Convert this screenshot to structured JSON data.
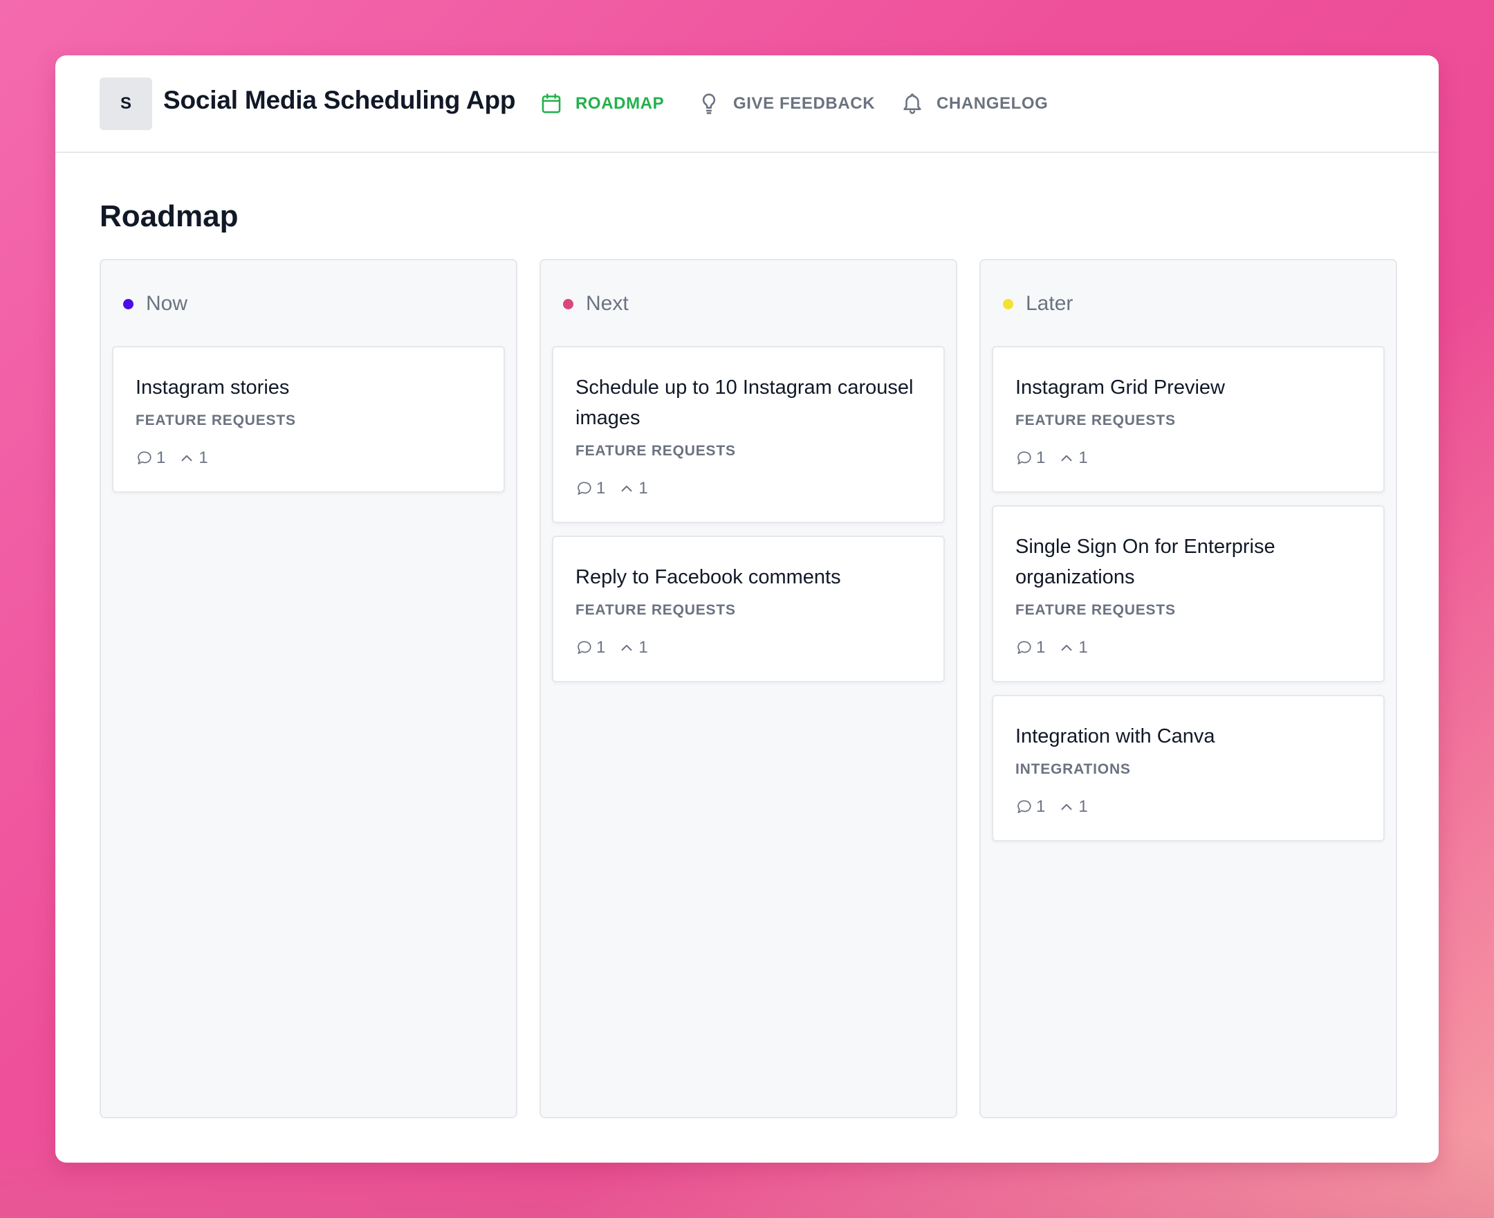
{
  "app": {
    "logo_letter": "S",
    "title": "Social Media Scheduling App"
  },
  "nav": {
    "items": [
      {
        "label": "ROADMAP",
        "icon": "calendar-icon",
        "active": true
      },
      {
        "label": "GIVE FEEDBACK",
        "icon": "lightbulb-icon",
        "active": false
      },
      {
        "label": "CHANGELOG",
        "icon": "bell-icon",
        "active": false
      }
    ]
  },
  "page": {
    "title": "Roadmap"
  },
  "colors": {
    "active_nav": "#22b14c",
    "now_dot": "#4a0fe8",
    "next_dot": "#d9477e",
    "later_dot": "#f5e132"
  },
  "columns": [
    {
      "name": "Now",
      "dot_color": "#4a0fe8",
      "cards": [
        {
          "title": "Instagram stories",
          "category": "FEATURE REQUESTS",
          "comments": "1",
          "upvotes": "1"
        }
      ]
    },
    {
      "name": "Next",
      "dot_color": "#d9477e",
      "cards": [
        {
          "title": "Schedule up to 10 Instagram carousel images",
          "category": "FEATURE REQUESTS",
          "comments": "1",
          "upvotes": "1"
        },
        {
          "title": "Reply to Facebook comments",
          "category": "FEATURE REQUESTS",
          "comments": "1",
          "upvotes": "1"
        }
      ]
    },
    {
      "name": "Later",
      "dot_color": "#f5e132",
      "cards": [
        {
          "title": "Instagram Grid Preview",
          "category": "FEATURE REQUESTS",
          "comments": "1",
          "upvotes": "1"
        },
        {
          "title": "Single Sign On for Enterprise organizations",
          "category": "FEATURE REQUESTS",
          "comments": "1",
          "upvotes": "1"
        },
        {
          "title": "Integration with Canva",
          "category": "INTEGRATIONS",
          "comments": "1",
          "upvotes": "1"
        }
      ]
    }
  ]
}
